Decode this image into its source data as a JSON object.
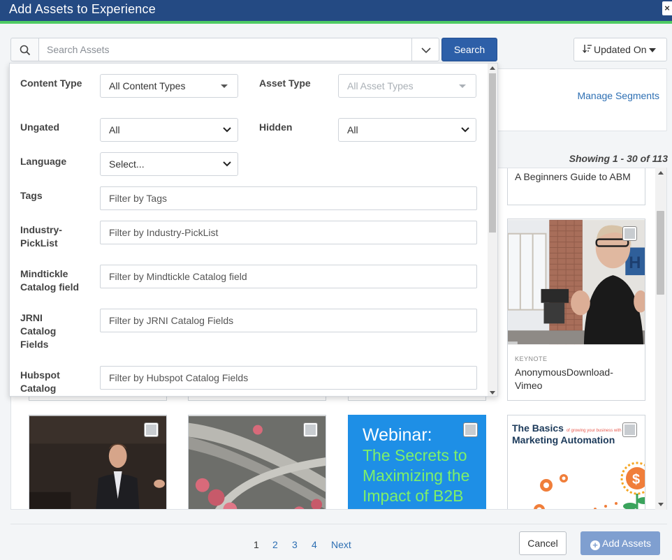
{
  "window": {
    "title": "Add Assets to Experience",
    "close_label": "×"
  },
  "search": {
    "placeholder": "Search Assets",
    "button_label": "Search"
  },
  "sort": {
    "label": "Updated On"
  },
  "segments": {
    "manage_label": "Manage Segments"
  },
  "results": {
    "showing_text": "Showing 1 - 30 of 113"
  },
  "filters": {
    "content_type": {
      "label": "Content Type",
      "value": "All Content Types"
    },
    "asset_type": {
      "label": "Asset Type",
      "value": "All Asset Types"
    },
    "ungated": {
      "label": "Ungated",
      "value": "All"
    },
    "hidden": {
      "label": "Hidden",
      "value": "All"
    },
    "language": {
      "label": "Language",
      "value": "Select..."
    },
    "tags": {
      "label": "Tags",
      "placeholder": "Filter by Tags"
    },
    "industry": {
      "label": "Industry-PickList",
      "placeholder": "Filter by Industry-PickList"
    },
    "mindtickle": {
      "label": "Mindtickle Catalog field",
      "placeholder": "Filter by Mindtickle Catalog field"
    },
    "jrni": {
      "label": "JRNI Catalog Fields",
      "placeholder": "Filter by JRNI Catalog Fields"
    },
    "hubspot": {
      "label": "Hubspot Catalog",
      "placeholder": "Filter by Hubspot Catalog Fields"
    }
  },
  "cards": {
    "abm": {
      "name": "A Beginners Guide to ABM"
    },
    "vimeo": {
      "category": "KEYNOTE",
      "name": "AnonymousDownload-Vimeo"
    },
    "webinar": {
      "line1": "Webinar:",
      "line2": "The Secrets to Maximizing the Impact of B2B"
    },
    "marketing": {
      "line1": "The Basics",
      "line1_small": "of growing your business with",
      "line2": "Marketing Automation"
    }
  },
  "pagination": {
    "pages": [
      "1",
      "2",
      "3",
      "4"
    ],
    "next_label": "Next"
  },
  "footer": {
    "cancel_label": "Cancel",
    "add_label": "Add Assets"
  },
  "colors": {
    "header": "#244a83",
    "accent_green": "#4fcb64",
    "primary": "#2d5fa8",
    "link": "#2d6fb3",
    "webinar_bg": "#1e8fe6",
    "webinar_text": "#7ef06a"
  }
}
